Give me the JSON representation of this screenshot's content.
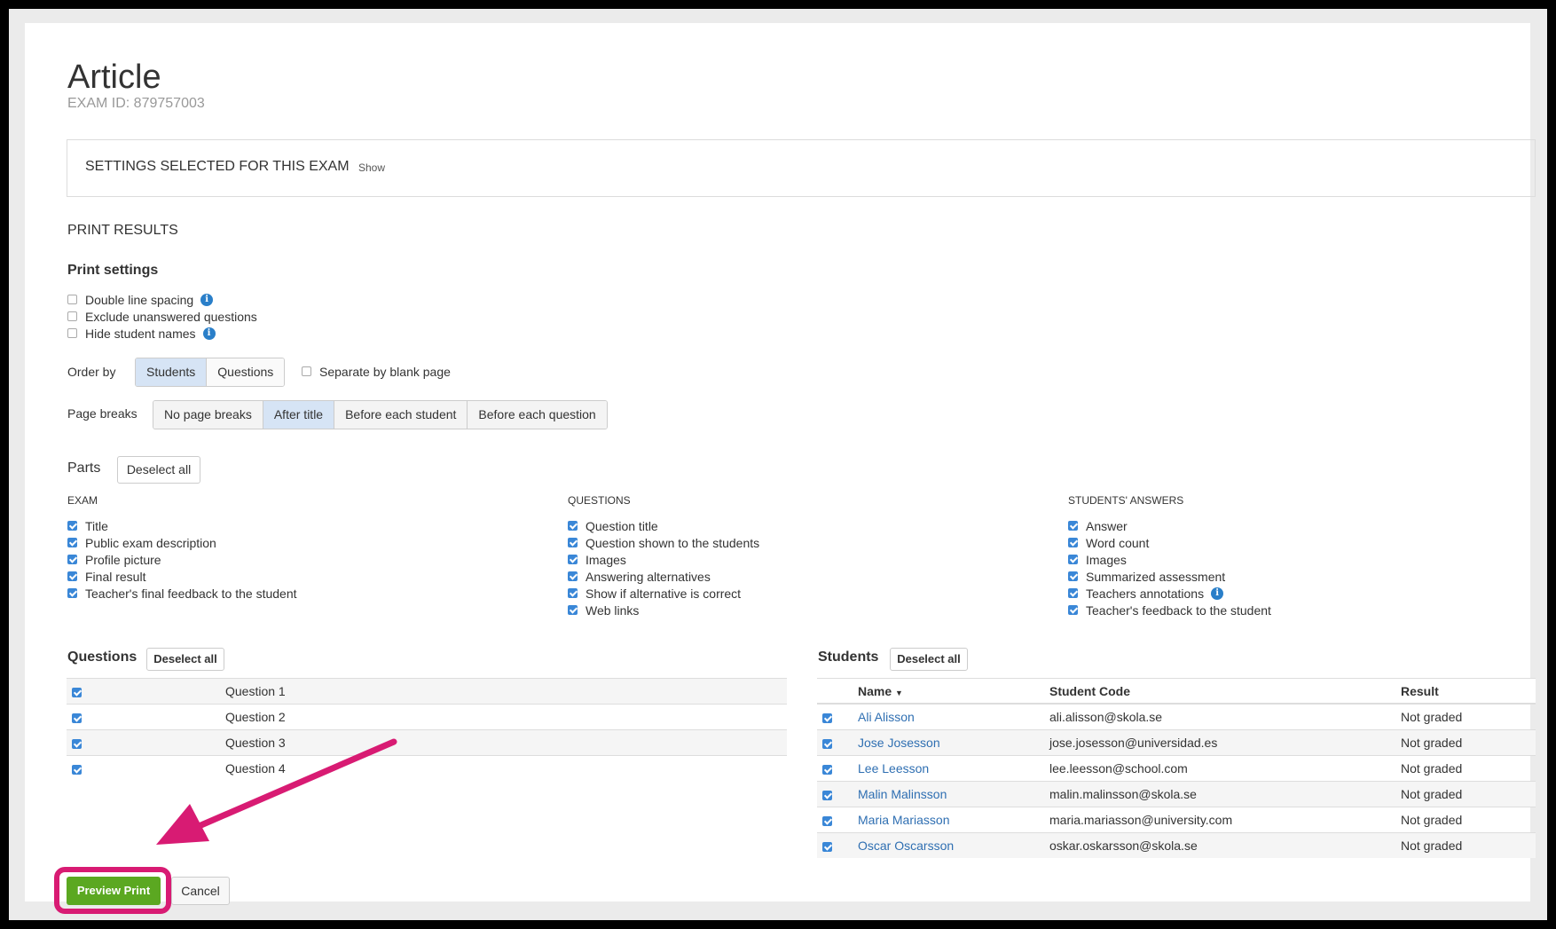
{
  "page": {
    "title": "Article",
    "exam_id": "EXAM ID: 879757003"
  },
  "settings_box": {
    "label": "SETTINGS SELECTED FOR THIS EXAM",
    "show_link": "Show"
  },
  "print_results": {
    "heading": "PRINT RESULTS",
    "print_settings_title": "Print settings",
    "options": [
      {
        "label": "Double line spacing",
        "checked": false,
        "info": true
      },
      {
        "label": "Exclude unanswered questions",
        "checked": false,
        "info": false
      },
      {
        "label": "Hide student names",
        "checked": false,
        "info": true
      }
    ],
    "order_by": {
      "label": "Order by",
      "options": [
        "Students",
        "Questions"
      ],
      "selected": "Students",
      "separate_label": "Separate by blank page",
      "separate_checked": false
    },
    "page_breaks": {
      "label": "Page breaks",
      "options": [
        "No page breaks",
        "After title",
        "Before each student",
        "Before each question"
      ],
      "selected": "After title"
    }
  },
  "parts": {
    "title": "Parts",
    "deselect_label": "Deselect all",
    "exam": {
      "heading": "EXAM",
      "items": [
        "Title",
        "Public exam description",
        "Profile picture",
        "Final result",
        "Teacher's final feedback to the student"
      ]
    },
    "questions": {
      "heading": "QUESTIONS",
      "items": [
        "Question title",
        "Question shown to the students",
        "Images",
        "Answering alternatives",
        "Show if alternative is correct",
        "Web links"
      ]
    },
    "students_answers": {
      "heading": "STUDENTS' ANSWERS",
      "items": [
        "Answer",
        "Word count",
        "Images",
        "Summarized assessment",
        "Teachers annotations",
        "Teacher's feedback to the student"
      ]
    },
    "info_icon": "i"
  },
  "questions_panel": {
    "title": "Questions",
    "deselect_label": "Deselect all",
    "rows": [
      "Question 1",
      "Question 2",
      "Question 3",
      "Question 4"
    ]
  },
  "students_panel": {
    "title": "Students",
    "deselect_label": "Deselect all",
    "columns": {
      "name": "Name",
      "code": "Student Code",
      "result": "Result"
    },
    "sort_icon": "caret-down-icon",
    "rows": [
      {
        "name": "Ali Alisson",
        "code": "ali.alisson@skola.se",
        "result": "Not graded"
      },
      {
        "name": "Jose Josesson",
        "code": "jose.josesson@universidad.es",
        "result": "Not graded"
      },
      {
        "name": "Lee Leesson",
        "code": "lee.leesson@school.com",
        "result": "Not graded"
      },
      {
        "name": "Malin Malinsson",
        "code": "malin.malinsson@skola.se",
        "result": "Not graded"
      },
      {
        "name": "Maria Mariasson",
        "code": "maria.mariasson@university.com",
        "result": "Not graded"
      },
      {
        "name": "Oscar Oscarsson",
        "code": "oskar.oskarsson@skola.se",
        "result": "Not graded"
      }
    ]
  },
  "footer": {
    "preview_label": "Preview Print",
    "cancel_label": "Cancel"
  },
  "colors": {
    "accent_green": "#5ba821",
    "highlight_pink": "#d81b73",
    "link_blue": "#2f6fb2",
    "checkbox_blue": "#3a87d7",
    "selected_segment": "#d6e4f5"
  }
}
